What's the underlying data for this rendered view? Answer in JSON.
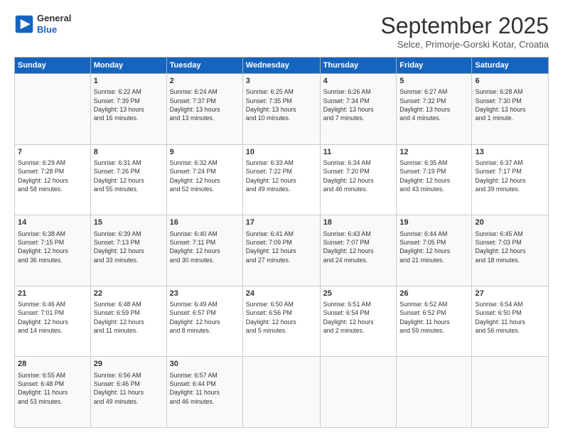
{
  "header": {
    "logo_line1": "General",
    "logo_line2": "Blue",
    "month_title": "September 2025",
    "subtitle": "Selce, Primorje-Gorski Kotar, Croatia"
  },
  "days_of_week": [
    "Sunday",
    "Monday",
    "Tuesday",
    "Wednesday",
    "Thursday",
    "Friday",
    "Saturday"
  ],
  "weeks": [
    [
      {
        "day": "",
        "info": ""
      },
      {
        "day": "1",
        "info": "Sunrise: 6:22 AM\nSunset: 7:39 PM\nDaylight: 13 hours\nand 16 minutes."
      },
      {
        "day": "2",
        "info": "Sunrise: 6:24 AM\nSunset: 7:37 PM\nDaylight: 13 hours\nand 13 minutes."
      },
      {
        "day": "3",
        "info": "Sunrise: 6:25 AM\nSunset: 7:35 PM\nDaylight: 13 hours\nand 10 minutes."
      },
      {
        "day": "4",
        "info": "Sunrise: 6:26 AM\nSunset: 7:34 PM\nDaylight: 13 hours\nand 7 minutes."
      },
      {
        "day": "5",
        "info": "Sunrise: 6:27 AM\nSunset: 7:32 PM\nDaylight: 13 hours\nand 4 minutes."
      },
      {
        "day": "6",
        "info": "Sunrise: 6:28 AM\nSunset: 7:30 PM\nDaylight: 13 hours\nand 1 minute."
      }
    ],
    [
      {
        "day": "7",
        "info": "Sunrise: 6:29 AM\nSunset: 7:28 PM\nDaylight: 12 hours\nand 58 minutes."
      },
      {
        "day": "8",
        "info": "Sunrise: 6:31 AM\nSunset: 7:26 PM\nDaylight: 12 hours\nand 55 minutes."
      },
      {
        "day": "9",
        "info": "Sunrise: 6:32 AM\nSunset: 7:24 PM\nDaylight: 12 hours\nand 52 minutes."
      },
      {
        "day": "10",
        "info": "Sunrise: 6:33 AM\nSunset: 7:22 PM\nDaylight: 12 hours\nand 49 minutes."
      },
      {
        "day": "11",
        "info": "Sunrise: 6:34 AM\nSunset: 7:20 PM\nDaylight: 12 hours\nand 46 minutes."
      },
      {
        "day": "12",
        "info": "Sunrise: 6:35 AM\nSunset: 7:19 PM\nDaylight: 12 hours\nand 43 minutes."
      },
      {
        "day": "13",
        "info": "Sunrise: 6:37 AM\nSunset: 7:17 PM\nDaylight: 12 hours\nand 39 minutes."
      }
    ],
    [
      {
        "day": "14",
        "info": "Sunrise: 6:38 AM\nSunset: 7:15 PM\nDaylight: 12 hours\nand 36 minutes."
      },
      {
        "day": "15",
        "info": "Sunrise: 6:39 AM\nSunset: 7:13 PM\nDaylight: 12 hours\nand 33 minutes."
      },
      {
        "day": "16",
        "info": "Sunrise: 6:40 AM\nSunset: 7:11 PM\nDaylight: 12 hours\nand 30 minutes."
      },
      {
        "day": "17",
        "info": "Sunrise: 6:41 AM\nSunset: 7:09 PM\nDaylight: 12 hours\nand 27 minutes."
      },
      {
        "day": "18",
        "info": "Sunrise: 6:43 AM\nSunset: 7:07 PM\nDaylight: 12 hours\nand 24 minutes."
      },
      {
        "day": "19",
        "info": "Sunrise: 6:44 AM\nSunset: 7:05 PM\nDaylight: 12 hours\nand 21 minutes."
      },
      {
        "day": "20",
        "info": "Sunrise: 6:45 AM\nSunset: 7:03 PM\nDaylight: 12 hours\nand 18 minutes."
      }
    ],
    [
      {
        "day": "21",
        "info": "Sunrise: 6:46 AM\nSunset: 7:01 PM\nDaylight: 12 hours\nand 14 minutes."
      },
      {
        "day": "22",
        "info": "Sunrise: 6:48 AM\nSunset: 6:59 PM\nDaylight: 12 hours\nand 11 minutes."
      },
      {
        "day": "23",
        "info": "Sunrise: 6:49 AM\nSunset: 6:57 PM\nDaylight: 12 hours\nand 8 minutes."
      },
      {
        "day": "24",
        "info": "Sunrise: 6:50 AM\nSunset: 6:56 PM\nDaylight: 12 hours\nand 5 minutes."
      },
      {
        "day": "25",
        "info": "Sunrise: 6:51 AM\nSunset: 6:54 PM\nDaylight: 12 hours\nand 2 minutes."
      },
      {
        "day": "26",
        "info": "Sunrise: 6:52 AM\nSunset: 6:52 PM\nDaylight: 11 hours\nand 59 minutes."
      },
      {
        "day": "27",
        "info": "Sunrise: 6:54 AM\nSunset: 6:50 PM\nDaylight: 11 hours\nand 56 minutes."
      }
    ],
    [
      {
        "day": "28",
        "info": "Sunrise: 6:55 AM\nSunset: 6:48 PM\nDaylight: 11 hours\nand 53 minutes."
      },
      {
        "day": "29",
        "info": "Sunrise: 6:56 AM\nSunset: 6:46 PM\nDaylight: 11 hours\nand 49 minutes."
      },
      {
        "day": "30",
        "info": "Sunrise: 6:57 AM\nSunset: 6:44 PM\nDaylight: 11 hours\nand 46 minutes."
      },
      {
        "day": "",
        "info": ""
      },
      {
        "day": "",
        "info": ""
      },
      {
        "day": "",
        "info": ""
      },
      {
        "day": "",
        "info": ""
      }
    ]
  ]
}
